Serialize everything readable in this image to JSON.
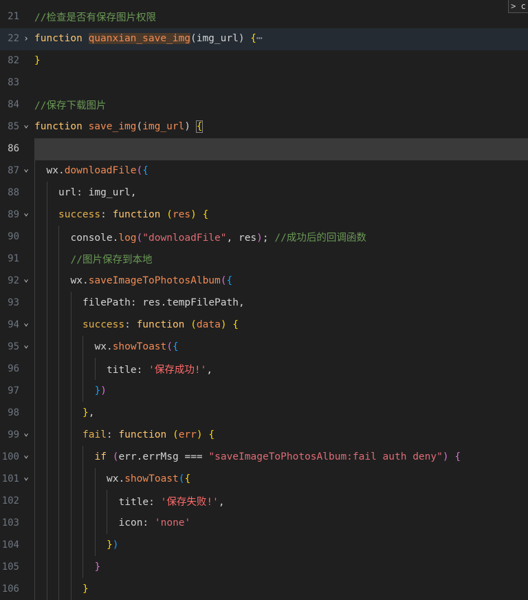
{
  "editor": {
    "lines": [
      {
        "num": "21",
        "fold": "",
        "indent": 0,
        "tokens": [
          [
            "comment",
            "//检查是否有保存图片权限"
          ]
        ]
      },
      {
        "num": "22",
        "fold": ">",
        "indent": 0,
        "tokens": [
          [
            "kw",
            "function"
          ],
          [
            "plain",
            " "
          ],
          [
            "fnhl",
            "quanxian_save_img"
          ],
          [
            "plain",
            "(img_url) "
          ],
          [
            "brace1",
            "{"
          ],
          [
            "ellipsis",
            "⋯"
          ]
        ]
      },
      {
        "num": "82",
        "fold": "",
        "indent": 0,
        "tokens": [
          [
            "brace1",
            "}"
          ]
        ]
      },
      {
        "num": "83",
        "fold": "",
        "indent": 0,
        "tokens": []
      },
      {
        "num": "84",
        "fold": "",
        "indent": 0,
        "tokens": [
          [
            "comment",
            "//保存下载图片"
          ]
        ]
      },
      {
        "num": "85",
        "fold": "v",
        "indent": 0,
        "tokens": [
          [
            "kw",
            "function"
          ],
          [
            "plain",
            " "
          ],
          [
            "fn",
            "save_img"
          ],
          [
            "plain",
            "("
          ],
          [
            "paramname",
            "img_url"
          ],
          [
            "plain",
            ") "
          ],
          [
            "bracebox",
            "{"
          ]
        ]
      },
      {
        "num": "86",
        "fold": "",
        "indent": 0,
        "tokens": []
      },
      {
        "num": "87",
        "fold": "v",
        "indent": 1,
        "tokens": [
          [
            "plain",
            "wx."
          ],
          [
            "method",
            "downloadFile"
          ],
          [
            "brace2",
            "("
          ],
          [
            "brace3",
            "{"
          ]
        ]
      },
      {
        "num": "88",
        "fold": "",
        "indent": 2,
        "tokens": [
          [
            "plain",
            "url: img_url,"
          ]
        ]
      },
      {
        "num": "89",
        "fold": "v",
        "indent": 2,
        "tokens": [
          [
            "key",
            "success"
          ],
          [
            "plain",
            ": "
          ],
          [
            "kw",
            "function"
          ],
          [
            "plain",
            " "
          ],
          [
            "brace1",
            "("
          ],
          [
            "paramname",
            "res"
          ],
          [
            "brace1",
            ")"
          ],
          [
            "plain",
            " "
          ],
          [
            "brace1",
            "{"
          ]
        ]
      },
      {
        "num": "90",
        "fold": "",
        "indent": 3,
        "tokens": [
          [
            "plain",
            "console."
          ],
          [
            "method",
            "log"
          ],
          [
            "brace2",
            "("
          ],
          [
            "str",
            "\"downloadFile\""
          ],
          [
            "plain",
            ", res"
          ],
          [
            "brace2",
            ")"
          ],
          [
            "plain",
            "; "
          ],
          [
            "comment",
            "//成功后的回调函数"
          ]
        ]
      },
      {
        "num": "91",
        "fold": "",
        "indent": 3,
        "tokens": [
          [
            "comment",
            "//图片保存到本地"
          ]
        ]
      },
      {
        "num": "92",
        "fold": "v",
        "indent": 3,
        "tokens": [
          [
            "plain",
            "wx."
          ],
          [
            "method",
            "saveImageToPhotosAlbum"
          ],
          [
            "brace2",
            "("
          ],
          [
            "brace3",
            "{"
          ]
        ]
      },
      {
        "num": "93",
        "fold": "",
        "indent": 4,
        "tokens": [
          [
            "plain",
            "filePath: res.tempFilePath,"
          ]
        ]
      },
      {
        "num": "94",
        "fold": "v",
        "indent": 4,
        "tokens": [
          [
            "key",
            "success"
          ],
          [
            "plain",
            ": "
          ],
          [
            "kw",
            "function"
          ],
          [
            "plain",
            " "
          ],
          [
            "brace1",
            "("
          ],
          [
            "paramname",
            "data"
          ],
          [
            "brace1",
            ")"
          ],
          [
            "plain",
            " "
          ],
          [
            "brace1",
            "{"
          ]
        ]
      },
      {
        "num": "95",
        "fold": "v",
        "indent": 5,
        "tokens": [
          [
            "plain",
            "wx."
          ],
          [
            "method",
            "showToast"
          ],
          [
            "brace2",
            "("
          ],
          [
            "brace3",
            "{"
          ]
        ]
      },
      {
        "num": "96",
        "fold": "",
        "indent": 6,
        "tokens": [
          [
            "plain",
            "title: "
          ],
          [
            "str",
            "'"
          ],
          [
            "strtxt",
            "保存成功!"
          ],
          [
            "str",
            "'"
          ],
          [
            "plain",
            ","
          ]
        ]
      },
      {
        "num": "97",
        "fold": "",
        "indent": 5,
        "tokens": [
          [
            "brace3",
            "}"
          ],
          [
            "brace2",
            ")"
          ]
        ]
      },
      {
        "num": "98",
        "fold": "",
        "indent": 4,
        "tokens": [
          [
            "brace1",
            "}"
          ],
          [
            "plain",
            ","
          ]
        ]
      },
      {
        "num": "99",
        "fold": "v",
        "indent": 4,
        "tokens": [
          [
            "key",
            "fail"
          ],
          [
            "plain",
            ": "
          ],
          [
            "kw",
            "function"
          ],
          [
            "plain",
            " "
          ],
          [
            "brace1",
            "("
          ],
          [
            "paramname",
            "err"
          ],
          [
            "brace1",
            ")"
          ],
          [
            "plain",
            " "
          ],
          [
            "brace1",
            "{"
          ]
        ]
      },
      {
        "num": "100",
        "fold": "v",
        "indent": 5,
        "tokens": [
          [
            "kw",
            "if"
          ],
          [
            "plain",
            " "
          ],
          [
            "brace2",
            "("
          ],
          [
            "plain",
            "err.errMsg === "
          ],
          [
            "str",
            "\"saveImageToPhotosAlbum:fail auth deny\""
          ],
          [
            "brace2",
            ")"
          ],
          [
            "plain",
            " "
          ],
          [
            "brace2",
            "{"
          ]
        ]
      },
      {
        "num": "101",
        "fold": "v",
        "indent": 6,
        "tokens": [
          [
            "plain",
            "wx."
          ],
          [
            "method",
            "showToast"
          ],
          [
            "brace3",
            "("
          ],
          [
            "brace1",
            "{"
          ]
        ]
      },
      {
        "num": "102",
        "fold": "",
        "indent": 7,
        "tokens": [
          [
            "plain",
            "title: "
          ],
          [
            "str",
            "'"
          ],
          [
            "strtxt",
            "保存失败!"
          ],
          [
            "str",
            "'"
          ],
          [
            "plain",
            ","
          ]
        ]
      },
      {
        "num": "103",
        "fold": "",
        "indent": 7,
        "tokens": [
          [
            "plain",
            "icon: "
          ],
          [
            "str",
            "'none'"
          ]
        ]
      },
      {
        "num": "104",
        "fold": "",
        "indent": 6,
        "tokens": [
          [
            "brace1",
            "}"
          ],
          [
            "brace3",
            ")"
          ]
        ]
      },
      {
        "num": "105",
        "fold": "",
        "indent": 5,
        "tokens": [
          [
            "brace2",
            "}"
          ]
        ]
      },
      {
        "num": "106",
        "fold": "",
        "indent": 4,
        "tokens": [
          [
            "brace1",
            "}"
          ]
        ]
      }
    ],
    "corner_button": "> c"
  },
  "colors": {
    "background": "#1f1f1f",
    "current_line": "#3a3a3a",
    "comment": "#6a9955",
    "keyword": "#ffc66d",
    "function": "#f28b54",
    "string": "#e06c75"
  }
}
